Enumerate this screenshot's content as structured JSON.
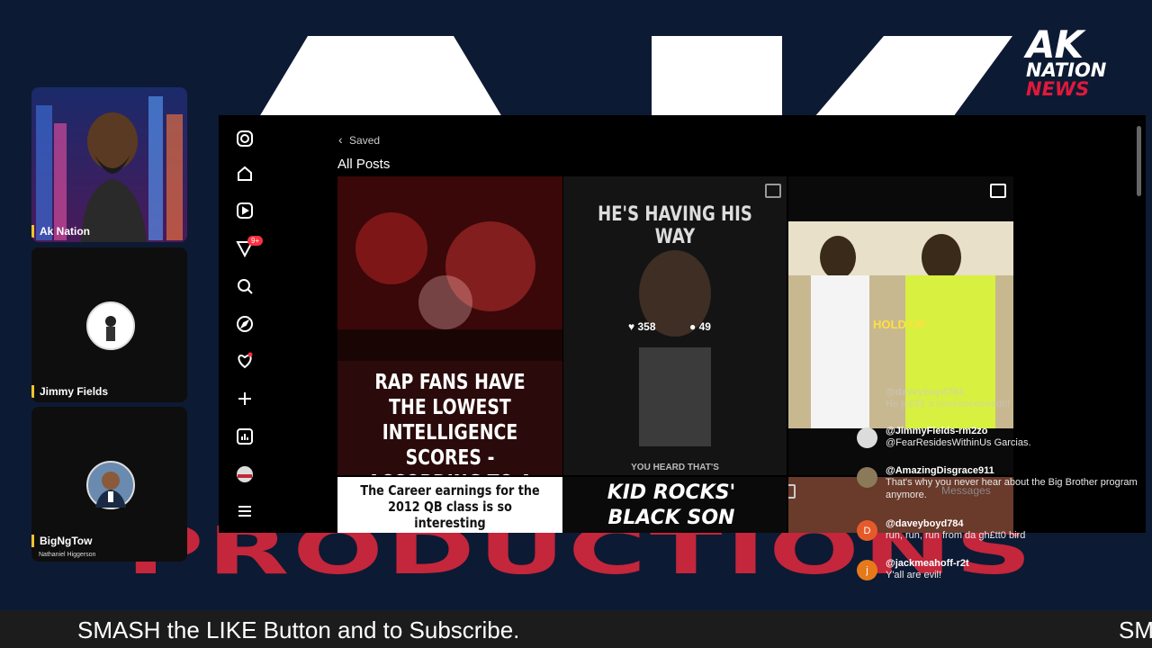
{
  "brand": {
    "logo_line1": "AK",
    "logo_line2": "NATION",
    "logo_line3": "NEWS",
    "background_text": "PRODUCTIONS"
  },
  "participants": [
    {
      "name": "Ak Nation",
      "subtitle": ""
    },
    {
      "name": "Jimmy Fields",
      "subtitle": ""
    },
    {
      "name": "BigNgTow",
      "subtitle": "Nathaniel Higgerson"
    }
  ],
  "instagram": {
    "notification_count": "9+",
    "back_label": "Saved",
    "section_title": "All Posts",
    "rail_icons": [
      "instagram-icon",
      "home-icon",
      "reels-icon",
      "messages-icon",
      "search-icon",
      "explore-icon",
      "notifications-icon",
      "create-icon",
      "dashboard-icon",
      "profile-icon",
      "menu-icon"
    ],
    "posts": [
      {
        "headline": "RAP FANS HAVE THE LOWEST INTELLIGENCE SCORES - ACCORDING TO A STUDY"
      },
      {
        "headline": "HE'S HAVING HIS WAY",
        "likes": "358",
        "comments": "49",
        "footer": "YOU HEARD THAT'S"
      },
      {
        "caption": "HOLD UP"
      },
      {
        "headline": "The Career earnings for the 2012 QB class is so interesting"
      },
      {
        "headline": "KID ROCKS' BLACK SON"
      }
    ],
    "messages_label": "Messages"
  },
  "chat": [
    {
      "user": "@daveyboyd784",
      "message": "He ju$$$ a keeeeeeeeeed!!!",
      "avatar": "",
      "faded": true
    },
    {
      "user": "@JimmyFields-rm2zo",
      "message": "@FearResidesWithinUs Garcias.",
      "avatar": "",
      "avatar_color": "#dcdcdc"
    },
    {
      "user": "@AmazingDisgrace911",
      "message": "That's why you never hear about the Big Brother program anymore.",
      "avatar": "",
      "avatar_color": "#8a7a5a"
    },
    {
      "user": "@daveyboyd784",
      "message": "run, run, run from da gh£tt0 bird",
      "avatar": "D",
      "avatar_color": "#e65a2a"
    },
    {
      "user": "@jackmeahoff-r2t",
      "message": "Y'all are evil!",
      "avatar": "j",
      "avatar_color": "#e67a1a"
    }
  ],
  "ticker": {
    "text": "SMASH the LIKE Button and to Subscribe.",
    "text_repeat": "SM"
  }
}
